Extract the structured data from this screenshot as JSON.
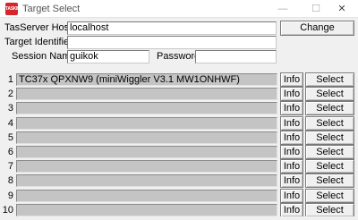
{
  "window": {
    "title": "Target Select",
    "app_icon_text": "TASKING",
    "min_glyph": "—",
    "max_glyph": "☐",
    "close_glyph": "✕"
  },
  "connection": {
    "host_label": "TasServer Host",
    "host_value": "localhost",
    "change_label": "Change",
    "identifier_label": "Target Identifier",
    "identifier_value": "",
    "session_label": "Session Name",
    "session_value": "guikok",
    "password_label": "Password",
    "password_value": ""
  },
  "targets": {
    "info_label": "Info",
    "select_label": "Select",
    "rows": [
      {
        "num": "1",
        "value": "TC37x QPXNW9 (miniWiggler V3.1 MW1ONHWF)"
      },
      {
        "num": "2",
        "value": ""
      },
      {
        "num": "3",
        "value": ""
      },
      {
        "num": "4",
        "value": ""
      },
      {
        "num": "5",
        "value": ""
      },
      {
        "num": "6",
        "value": ""
      },
      {
        "num": "7",
        "value": ""
      },
      {
        "num": "8",
        "value": ""
      },
      {
        "num": "9",
        "value": ""
      },
      {
        "num": "10",
        "value": ""
      }
    ]
  }
}
